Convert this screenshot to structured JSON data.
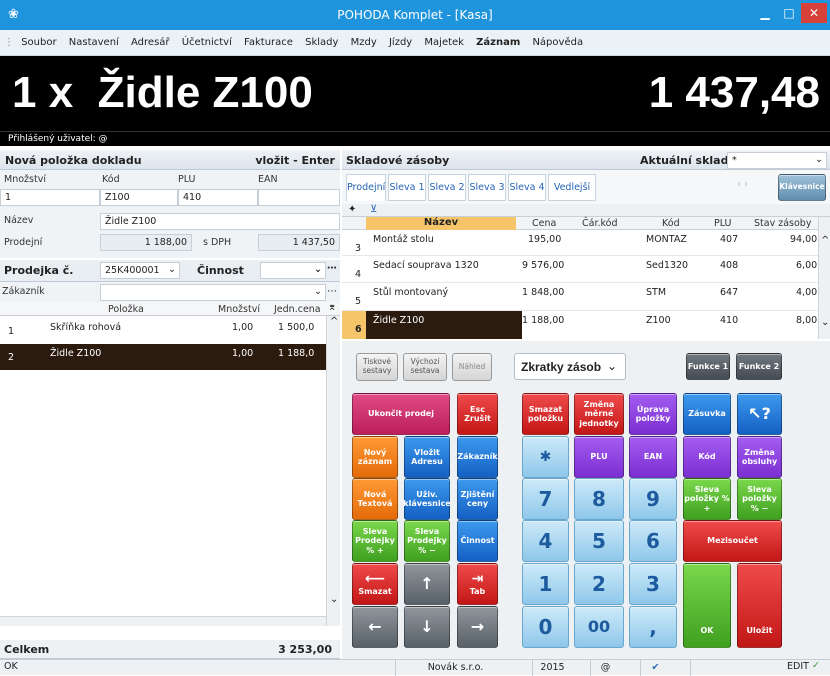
{
  "window": {
    "title": "POHODA Komplet - [Kasa]"
  },
  "menu": [
    "Soubor",
    "Nastavení",
    "Adresář",
    "Účetnictví",
    "Fakturace",
    "Sklady",
    "Mzdy",
    "Jízdy",
    "Majetek",
    "Záznam",
    "Nápověda"
  ],
  "display": {
    "item": "1 x  Židle Z100",
    "amount": "1 437,48"
  },
  "user_line": "Přihlášený uživatel: @",
  "new_item": {
    "header": "Nová položka dokladu",
    "insert_hint": "vložit - Enter",
    "labels": {
      "qty": "Množství",
      "code": "Kód",
      "plu": "PLU",
      "ean": "EAN",
      "name": "Název",
      "price": "Prodejní",
      "vat": "s DPH"
    },
    "values": {
      "qty": "1",
      "code": "Z100",
      "plu": "410",
      "ean": "",
      "name": "Židle Z100",
      "price": "1 188,00",
      "price_vat": "1 437,50"
    }
  },
  "receipt": {
    "label": "Prodejka č.",
    "number": "25K400001",
    "activity_label": "Činnost",
    "activity_value": "",
    "customer_label": "Zákazník",
    "customer_value": "",
    "columns": {
      "item": "Položka",
      "qty": "Množství",
      "unit_price": "Jedn.cena"
    },
    "rows": [
      {
        "n": "1",
        "item": "Skříňka rohová",
        "qty": "1,00",
        "price": "1 500,0"
      },
      {
        "n": "2",
        "item": "Židle Z100",
        "qty": "1,00",
        "price": "1 188,0"
      }
    ],
    "total_label": "Celkem",
    "total_value": "3 253,00"
  },
  "stock": {
    "header": "Skladové zásoby",
    "warehouse_label": "Aktuální sklad",
    "warehouse_value": "*",
    "tabs": [
      "Prodejní",
      "Sleva 1",
      "Sleva 2",
      "Sleva 3",
      "Sleva 4",
      "Vedlejší"
    ],
    "keyboard_btn": "Klávesnice",
    "columns": {
      "name": "Název",
      "price": "Cena",
      "barcode": "Čár.kód",
      "code": "Kód",
      "plu": "PLU",
      "stock": "Stav zásoby"
    },
    "rows": [
      {
        "n": "3",
        "name": "Montáž stolu",
        "price": "195,00",
        "barcode": "",
        "code": "MONTAZ",
        "plu": "407",
        "stock": "94,00"
      },
      {
        "n": "4",
        "name": "Sedací souprava 1320",
        "price": "9 576,00",
        "barcode": "",
        "code": "Sed1320",
        "plu": "408",
        "stock": "6,00"
      },
      {
        "n": "5",
        "name": "Stůl montovaný",
        "price": "1 848,00",
        "barcode": "",
        "code": "STM",
        "plu": "647",
        "stock": "4,00"
      },
      {
        "n": "6",
        "name": "Židle Z100",
        "price": "1 188,00",
        "barcode": "",
        "code": "Z100",
        "plu": "410",
        "stock": "8,00"
      }
    ]
  },
  "pad": {
    "print_sets": "Tiskové sestavy",
    "default_set": "Výchozí sestava",
    "preview": "Náhled",
    "shortcuts": "Zkratky zásob",
    "func1": "Funkce 1",
    "func2": "Funkce 2",
    "end_sale": "Ukončit prodej",
    "esc": "Esc Zrušit",
    "delete_item": "Smazat položku",
    "change_unit": "Změna měrné jednotky",
    "edit_items": "Úprava položky",
    "drawer": "Zásuvka",
    "help": "↖?",
    "new_record": "Nový záznam",
    "insert_address": "Vložit Adresu",
    "customer": "Zákazník",
    "star": "✱",
    "plu": "PLU",
    "ean": "EAN",
    "code": "Kód",
    "change_operator": "Změna obsluhy",
    "new_text": "Nová Textová",
    "user_keyboard": "Uživ. klávesnice",
    "find_price": "Zjištění ceny",
    "item_discount_plus": "Sleva položky % +",
    "item_discount_minus": "Sleva položky % −",
    "receipt_discount_plus": "Sleva Prodejky % +",
    "receipt_discount_minus": "Sleva Prodejky % −",
    "activity": "Činnost",
    "subtotal": "Mezisoučet",
    "backspace": "Smazat",
    "tab": "Tab",
    "ok": "OK",
    "save": "Uložit",
    "digits": [
      "7",
      "8",
      "9",
      "4",
      "5",
      "6",
      "1",
      "2",
      "3",
      "0",
      "00",
      ","
    ]
  },
  "status": {
    "left": "OK",
    "company": "Novák s.r.o.",
    "year": "2015",
    "at": "@",
    "mode": "EDIT"
  }
}
